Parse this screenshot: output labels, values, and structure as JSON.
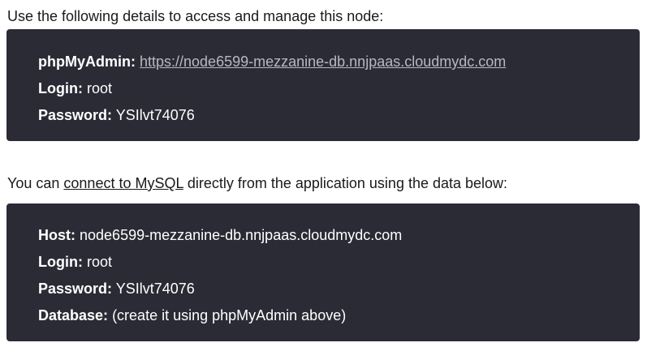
{
  "section1": {
    "intro": "Use the following details to access and manage this node:",
    "phpmyadmin_label": "phpMyAdmin:",
    "phpmyadmin_url": "https://node6599-mezzanine-db.nnjpaas.cloudmydc.com",
    "login_label": "Login:",
    "login_value": "root",
    "password_label": "Password:",
    "password_value": "YSIlvt74076"
  },
  "section2": {
    "intro_before": "You can ",
    "intro_link": "connect to MySQL",
    "intro_after": " directly from the application using the data below:",
    "host_label": "Host:",
    "host_value": "node6599-mezzanine-db.nnjpaas.cloudmydc.com",
    "login_label": "Login:",
    "login_value": "root",
    "password_label": "Password:",
    "password_value": "YSIlvt74076",
    "database_label": "Database:",
    "database_value": "(create it using phpMyAdmin above)"
  }
}
